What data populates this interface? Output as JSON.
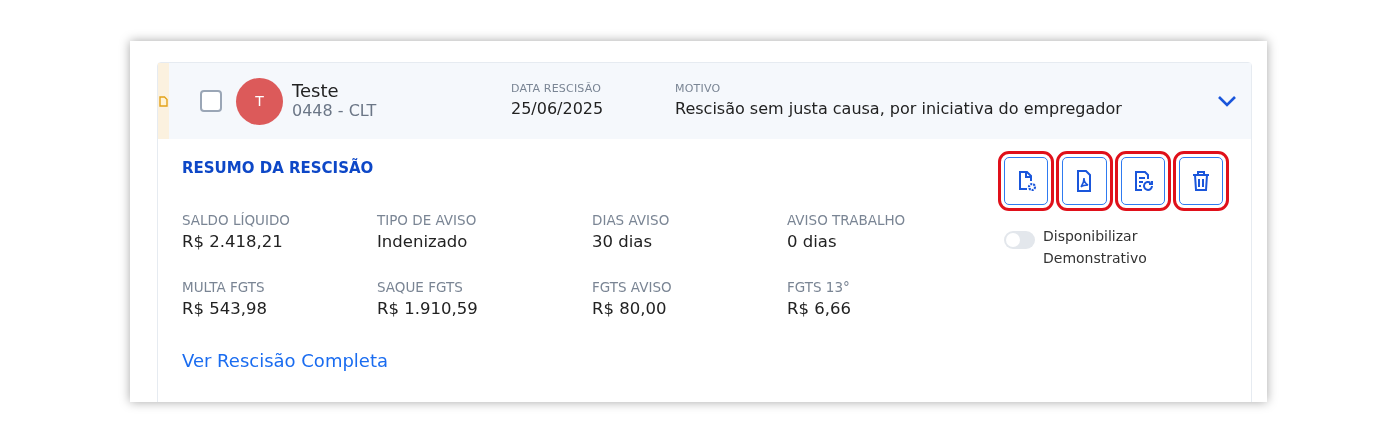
{
  "item": {
    "avatar_initial": "T",
    "name": "Teste",
    "subtitle": "0448 - CLT",
    "checked": false,
    "expanded": true,
    "fields": [
      {
        "label": "DATA RESCISÃO",
        "value": "25/06/2025"
      },
      {
        "label": "MOTIVO",
        "value": "Rescisão sem justa causa, por iniciativa do empregador"
      }
    ]
  },
  "summary": {
    "title": "RESUMO DA RESCISÃO",
    "stats": [
      {
        "label": "SALDO LÍQUIDO",
        "value": "R$ 2.418,21"
      },
      {
        "label": "TIPO DE AVISO",
        "value": "Indenizado"
      },
      {
        "label": "DIAS AVISO",
        "value": "30 dias"
      },
      {
        "label": "AVISO TRABALHO",
        "value": "0 dias"
      },
      {
        "label": "MULTA FGTS",
        "value": "R$ 543,98"
      },
      {
        "label": "SAQUE FGTS",
        "value": "R$ 1.910,59"
      },
      {
        "label": "FGTS AVISO",
        "value": "R$ 80,00"
      },
      {
        "label": "FGTS 13°",
        "value": "R$ 6,66"
      }
    ],
    "link": "Ver Rescisão Completa",
    "actions": [
      {
        "kind": "settings-doc",
        "highlighted": true
      },
      {
        "kind": "pdf",
        "highlighted": true
      },
      {
        "kind": "refresh-doc",
        "highlighted": true
      },
      {
        "kind": "trash",
        "highlighted": true
      }
    ],
    "toggle": {
      "label": "Disponibilizar Demonstrativo",
      "on": false
    }
  }
}
